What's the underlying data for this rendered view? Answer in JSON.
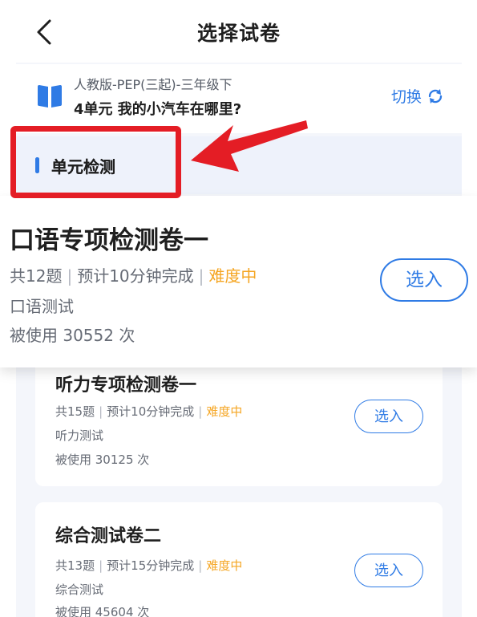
{
  "nav": {
    "title": "选择试卷"
  },
  "book": {
    "edition": "人教版-PEP(三起)-三年级下",
    "unit": "4单元 我的小汽车在哪里?",
    "switch_label": "切换"
  },
  "section": {
    "label": "单元检测"
  },
  "featured_paper": {
    "title": "口语专项检测卷一",
    "count": "共12题",
    "time": "预计10分钟完成",
    "difficulty": "难度中",
    "type": "口语测试",
    "usage": "被使用 30552 次",
    "select_label": "选入"
  },
  "papers": [
    {
      "title": "听力专项检测卷一",
      "count": "共15题",
      "time": "预计10分钟完成",
      "difficulty": "难度中",
      "type": "听力测试",
      "usage": "被使用 30125 次",
      "select_label": "选入"
    },
    {
      "title": "综合测试卷二",
      "count": "共13题",
      "time": "预计15分钟完成",
      "difficulty": "难度中",
      "type": "综合测试",
      "usage": "被使用 45604 次",
      "select_label": "选入"
    }
  ],
  "colors": {
    "accent": "#2f7be5",
    "difficulty": "#f5a623",
    "highlight": "#e41d25",
    "background": "#f4f6fb"
  }
}
